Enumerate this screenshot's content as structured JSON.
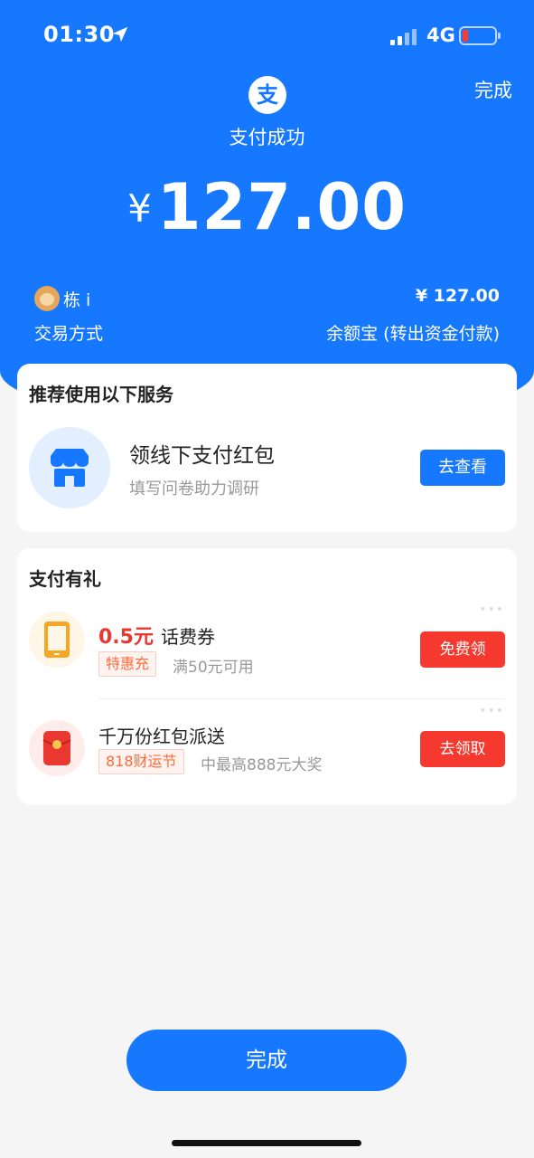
{
  "status_bar": {
    "time": "01:30",
    "network": "4G"
  },
  "header": {
    "done_label": "完成",
    "title": "支付成功",
    "currency_symbol": "¥",
    "amount": "127.00"
  },
  "transaction": {
    "payee_name": "栋 i",
    "payee_amount": "¥ 127.00",
    "method_label": "交易方式",
    "method_value": "余额宝 (转出资金付款)"
  },
  "recommend": {
    "title": "推荐使用以下服务",
    "item": {
      "title": "领线下支付红包",
      "subtitle": "填写问卷助力调研",
      "button": "去查看",
      "icon": "store-icon"
    }
  },
  "gifts": {
    "title": "支付有礼",
    "items": [
      {
        "highlight": "0.5元",
        "title": "话费券",
        "tag": "特惠充",
        "desc": "满50元可用",
        "button": "免费领",
        "icon": "phone-icon"
      },
      {
        "highlight": "",
        "title": "千万份红包派送",
        "tag": "818财运节",
        "desc": "中最高888元大奖",
        "button": "去领取",
        "icon": "red-packet-icon"
      }
    ]
  },
  "footer": {
    "done_label": "完成"
  },
  "colors": {
    "brand_blue": "#1677ff",
    "alert_red": "#f5392f"
  }
}
